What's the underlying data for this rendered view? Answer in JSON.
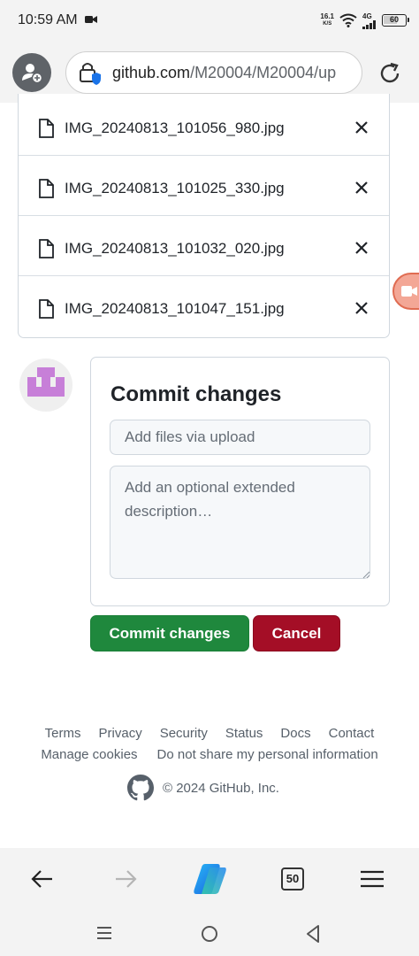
{
  "status_bar": {
    "time": "10:59 AM",
    "net_speed_value": "16.1",
    "net_speed_unit": "K/S",
    "network_type": "4G",
    "battery": "60"
  },
  "browser": {
    "url_domain": "github.com",
    "url_path": "/M20004/M20004/up"
  },
  "upload": {
    "files": [
      {
        "name": "IMG_20240813_101056_980.jpg"
      },
      {
        "name": "IMG_20240813_101025_330.jpg"
      },
      {
        "name": "IMG_20240813_101032_020.jpg"
      },
      {
        "name": "IMG_20240813_101047_151.jpg"
      }
    ]
  },
  "commit": {
    "title": "Commit changes",
    "summary_placeholder": "Add files via upload",
    "description_placeholder": "Add an optional extended description…",
    "commit_button": "Commit changes",
    "cancel_button": "Cancel"
  },
  "footer": {
    "links_row1": [
      "Terms",
      "Privacy",
      "Security",
      "Status",
      "Docs",
      "Contact"
    ],
    "links_row2": [
      "Manage cookies",
      "Do not share my personal information"
    ],
    "copyright": "© 2024 GitHub, Inc."
  },
  "bottom_bar": {
    "tab_count": "50"
  },
  "colors": {
    "commit_green": "#1f883d",
    "cancel_red": "#a40e26",
    "avatar_purple": "#c77fd8"
  }
}
